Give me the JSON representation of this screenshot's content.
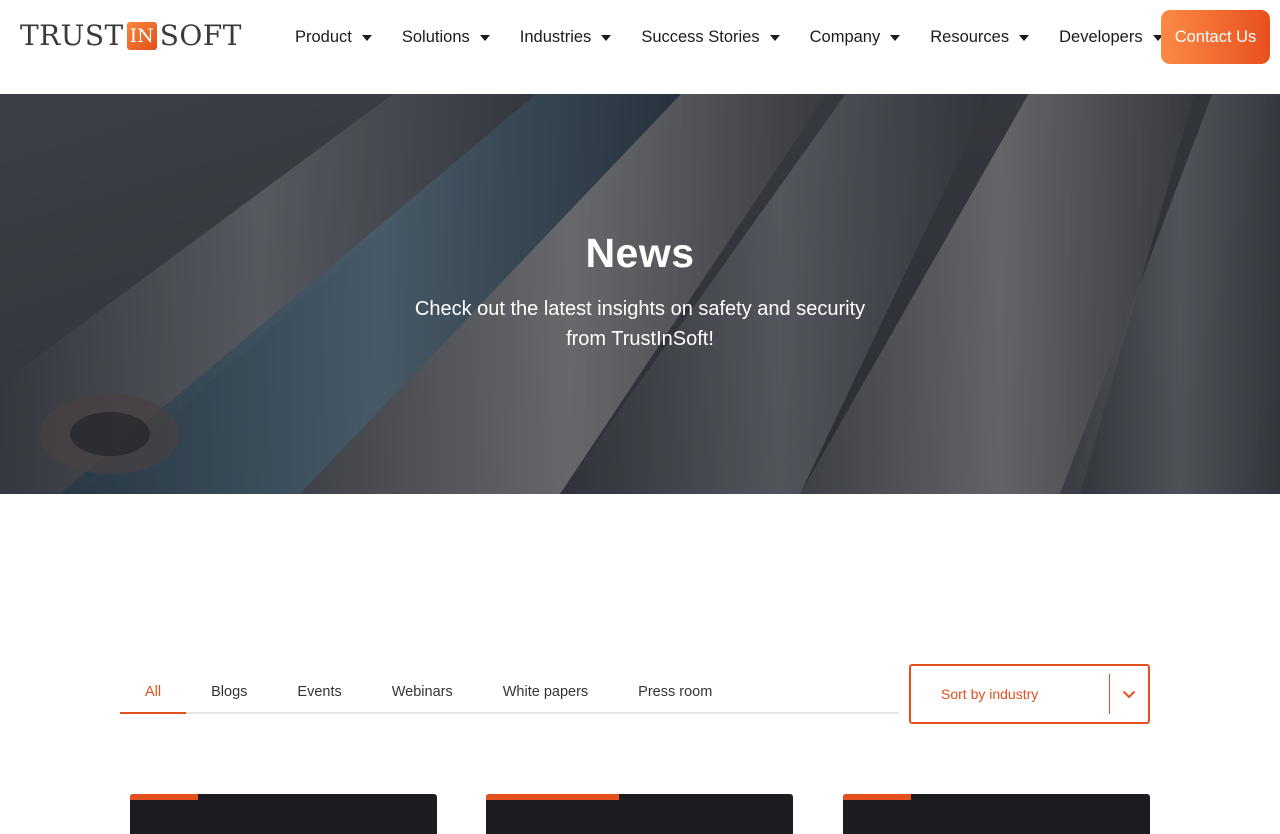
{
  "header": {
    "logo": {
      "word_left": "TRUST",
      "word_box": "IN",
      "word_right": "SOFT"
    },
    "nav": [
      {
        "label": "Product",
        "icon": "caret-down-icon"
      },
      {
        "label": "Solutions",
        "icon": "caret-down-icon"
      },
      {
        "label": "Industries",
        "icon": "caret-down-icon"
      },
      {
        "label": "Success Stories",
        "icon": "caret-down-icon"
      },
      {
        "label": "Company",
        "icon": "caret-down-icon"
      },
      {
        "label": "Resources",
        "icon": "caret-down-icon"
      },
      {
        "label": "Developers",
        "icon": "caret-down-icon"
      }
    ],
    "contact_label": "Contact Us"
  },
  "hero": {
    "title": "News",
    "subtitle": "Check out the latest insights on safety and security from TrustInSoft!"
  },
  "filters": {
    "tabs": [
      {
        "label": "All",
        "active": true
      },
      {
        "label": "Blogs",
        "active": false
      },
      {
        "label": "Events",
        "active": false
      },
      {
        "label": "Webinars",
        "active": false
      },
      {
        "label": "White papers",
        "active": false
      },
      {
        "label": "Press room",
        "active": false
      }
    ],
    "sort_label": "Sort by industry",
    "sort_icon": "chevron-down-icon"
  },
  "colors": {
    "accent": "#e4501e",
    "accent_light": "#fb8a45",
    "text": "#1a1a1a"
  }
}
